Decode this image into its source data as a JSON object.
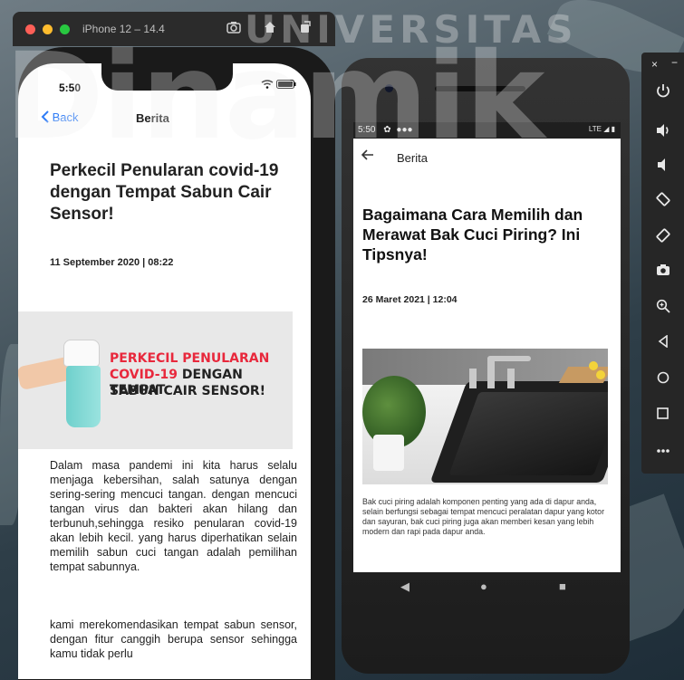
{
  "watermark": {
    "top": "UNIVERSITAS",
    "main": "Dinamik"
  },
  "simulator": {
    "title": "iPhone 12 – 14.4",
    "screenshot_icon": "camera-icon",
    "home_icon": "home-icon",
    "rotate_icon": "rotate-icon"
  },
  "ios": {
    "time": "5:50",
    "status_icons": "wifi-icon battery-icon",
    "back_label": "Back",
    "nav_title": "Berita",
    "headline": "Perkecil Penularan covid-19 dengan Tempat Sabun Cair Sensor!",
    "date": "11 September 2020 | 08:22",
    "banner": {
      "line1": "PERKECIL PENULARAN",
      "line2a": "COVID-19",
      "line2b": " DENGAN TEMPAT",
      "line3": "SABUN CAIR SENSOR!",
      "red": "#e8283c",
      "dark": "#222222"
    },
    "paragraph1": "Dalam masa pandemi ini kita harus selalu menjaga kebersihan, salah satunya dengan sering-sering mencuci tangan. dengan mencuci tangan virus dan bakteri akan hilang dan terbunuh,sehingga resiko penularan covid-19 akan lebih kecil. yang harus diperhatikan selain memilih sabun cuci tangan adalah pemilihan tempat sabunnya.",
    "paragraph2": "kami merekomendasikan tempat sabun sensor, dengan fitur canggih berupa sensor sehingga kamu tidak perlu"
  },
  "android": {
    "time": "5:50",
    "status_right": "LTE",
    "nav_title": "Berita",
    "headline": "Bagaimana Cara Memilih dan Merawat Bak Cuci Piring? Ini Tipsnya!",
    "date": "26 Maret 2021 | 12:04",
    "body": "Bak cuci piring adalah komponen penting yang ada di dapur anda, selain berfungsi sebagai tempat mencuci peralatan dapur yang kotor dan sayuran, bak cuci piring juga akan memberi kesan yang lebih modern dan rapi pada dapur anda.",
    "nav": {
      "back": "◀",
      "home": "●",
      "recents": "■"
    }
  },
  "emulator_toolbar": {
    "close": "×",
    "minimize": "−",
    "buttons": [
      "power-icon",
      "volume-up-icon",
      "volume-down-icon",
      "rotate-left-icon",
      "rotate-right-icon",
      "camera-icon",
      "zoom-icon",
      "back-icon",
      "home-icon",
      "overview-icon",
      "more-icon"
    ]
  },
  "colors": {
    "ios_accent": "#2f7cf6",
    "traffic_red": "#fe5f57",
    "traffic_yellow": "#febc2e",
    "traffic_green": "#28c840"
  }
}
